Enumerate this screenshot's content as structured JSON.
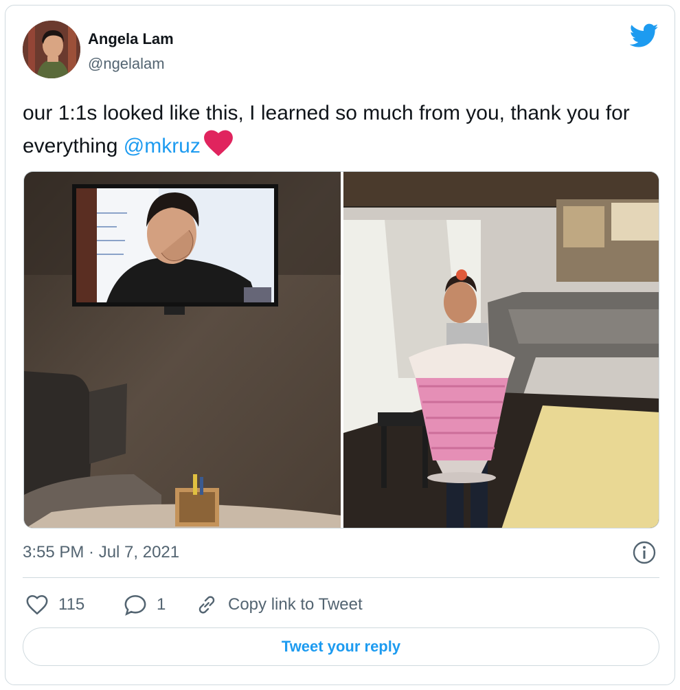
{
  "colors": {
    "accent": "#1d9bf0",
    "text": "#0f1419",
    "muted": "#536471",
    "heart": "#e0245e",
    "border": "#cfd9de"
  },
  "author": {
    "name": "Angela Lam",
    "handle": "@ngelalam",
    "avatar_icon": "profile-avatar"
  },
  "tweet": {
    "text": "our 1:1s looked like this, I learned so much from you, thank you for everything ",
    "mention": "@mkruz",
    "emoji": "heart-icon"
  },
  "media": {
    "left_photo": "office-tv-video-call-photo",
    "right_photo": "milkshake-costume-video-call-photo"
  },
  "meta": {
    "timestamp": "3:55 PM · Jul 7, 2021"
  },
  "actions": {
    "like_count": "115",
    "reply_count": "1",
    "copy_link_label": "Copy link to Tweet"
  },
  "reply_button_label": "Tweet your reply"
}
